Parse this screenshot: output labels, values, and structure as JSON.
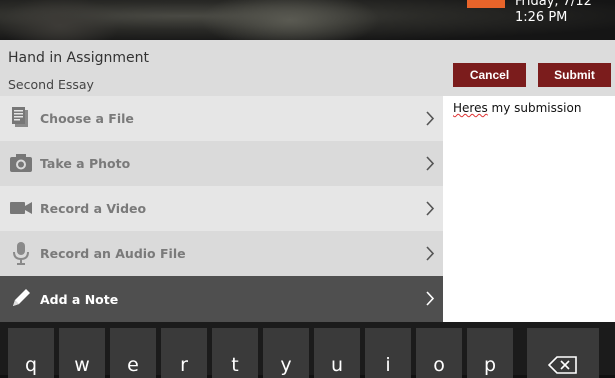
{
  "status": {
    "date_partial": "Friday, 7/12",
    "time": "1:26 PM",
    "tile_color": "#e8642a"
  },
  "sheet": {
    "title": "Hand in Assignment",
    "subtitle": "Second Essay",
    "cancel_label": "Cancel",
    "submit_label": "Submit",
    "accent": "#7b1c1c"
  },
  "options": [
    {
      "label": "Choose a File",
      "icon": "document-icon"
    },
    {
      "label": "Take a Photo",
      "icon": "camera-icon"
    },
    {
      "label": "Record a Video",
      "icon": "video-camera-icon"
    },
    {
      "label": "Record an Audio File",
      "icon": "microphone-icon"
    },
    {
      "label": "Add a Note",
      "icon": "pencil-icon",
      "selected": true
    }
  ],
  "note": {
    "text_misspelled": "Heres",
    "text_rest": " my submission"
  },
  "keyboard": {
    "keys": [
      "q",
      "w",
      "e",
      "r",
      "t",
      "y",
      "u",
      "i",
      "o",
      "p"
    ],
    "backspace_icon": "backspace-icon"
  }
}
